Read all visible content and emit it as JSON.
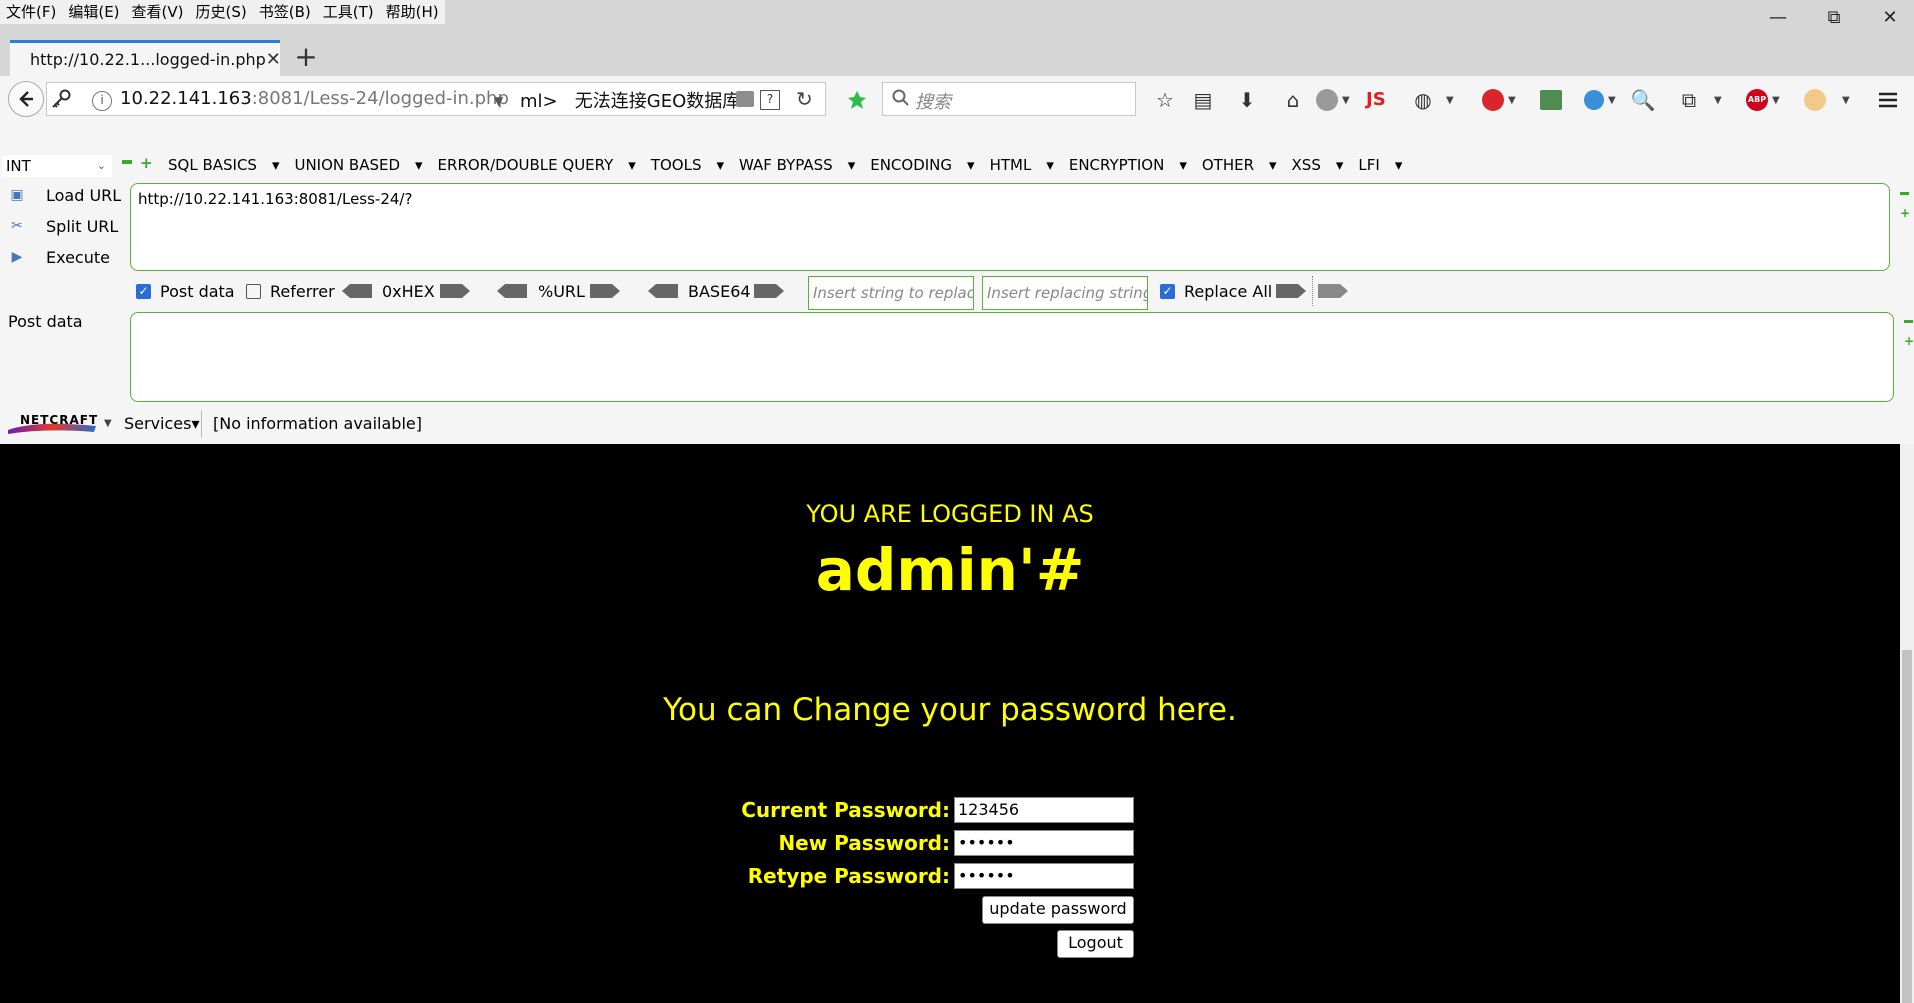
{
  "menubar": {
    "items": [
      "文件(F)",
      "编辑(E)",
      "查看(V)",
      "历史(S)",
      "书签(B)",
      "工具(T)",
      "帮助(H)"
    ]
  },
  "window_controls": {
    "minimize": "—",
    "restore": "⧉",
    "close": "✕"
  },
  "tab": {
    "title": "http://10.22.1...logged-in.php",
    "close": "✕",
    "new_tab": "+"
  },
  "navbar": {
    "url_host": "10.22.141.163",
    "url_rest": ":8081/Less-24/logged-in.php",
    "geo_prefix": "ml>",
    "geo_status": "无法连接GEO数据库",
    "search_placeholder": "搜索",
    "js_label": "JS",
    "abp_label": "ABP"
  },
  "hackbar": {
    "mode": "INT",
    "menus": [
      "SQL BASICS",
      "UNION BASED",
      "ERROR/DOUBLE QUERY",
      "TOOLS",
      "WAF BYPASS",
      "ENCODING",
      "HTML",
      "ENCRYPTION",
      "OTHER",
      "XSS",
      "LFI"
    ],
    "load_url": "Load URL",
    "split_url": "Split URL",
    "execute": "Execute",
    "url_value": "http://10.22.141.163:8081/Less-24/?",
    "post_data_checkbox": "Post data",
    "referrer_checkbox": "Referrer",
    "hex_label": "0xHEX",
    "url_enc_label": "%URL",
    "base64_label": "BASE64",
    "replace_from_placeholder": "Insert string to replace",
    "replace_to_placeholder": "Insert replacing string",
    "replace_all": "Replace All",
    "post_data_label": "Post data",
    "post_data_value": ""
  },
  "netcraft": {
    "logo": "NETCRAFT",
    "services": "Services",
    "info": "[No information available]"
  },
  "page": {
    "logged_in_as": "YOU ARE LOGGED IN AS",
    "username": "admin'#",
    "change_text": "You can Change your password here.",
    "current_password_label": "Current Password:",
    "current_password_value": "123456",
    "new_password_label": "New Password:",
    "new_password_value": "••••••",
    "retype_password_label": "Retype Password:",
    "retype_password_value": "••••••",
    "update_button": "update password",
    "logout_button": "Logout"
  },
  "colors": {
    "accent_green": "#59b13a",
    "text_yellow": "#ffff00",
    "tab_blue": "#2b7cd3"
  }
}
